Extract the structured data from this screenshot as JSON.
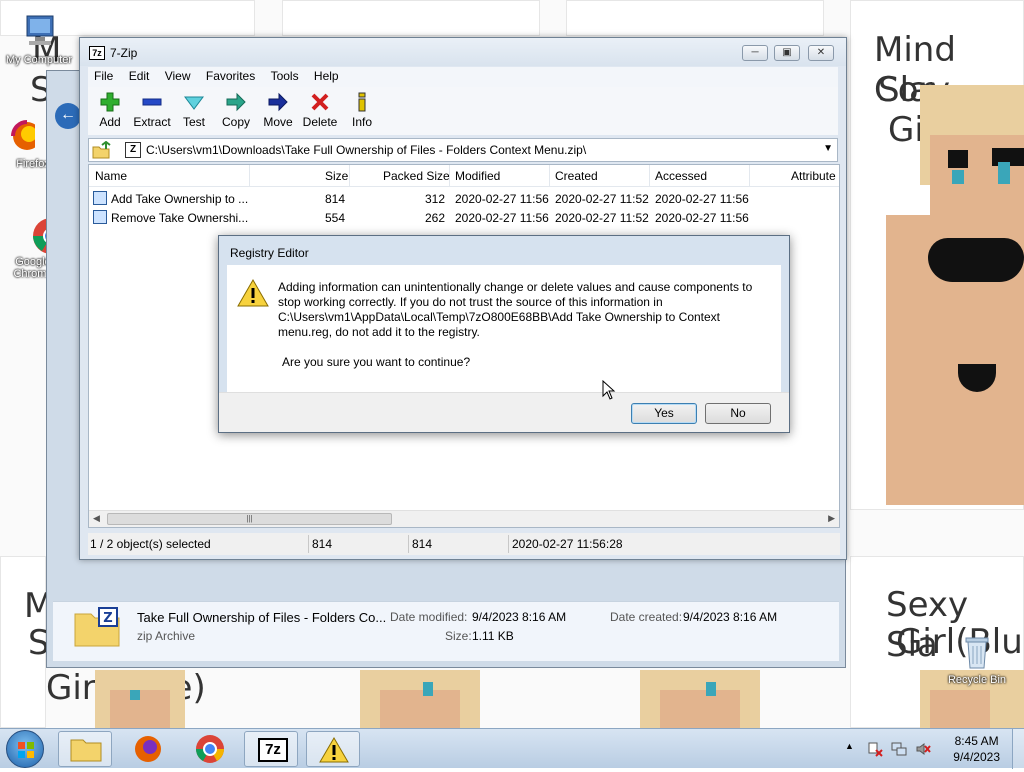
{
  "desktop": {
    "icons": [
      {
        "label": "My Computer"
      },
      {
        "label": "Firefox"
      },
      {
        "label": "Google Chrome"
      },
      {
        "label": "Recycle Bin"
      }
    ],
    "wallpaper_texts": [
      "Mind Cor",
      "Slav",
      "Gi",
      "Sexy Sla",
      "Girl(Blu",
      "Gir",
      "ue)",
      "Mi",
      "S",
      "M",
      "S"
    ]
  },
  "explorer": {
    "details": {
      "name": "Take Full Ownership of Files - Folders Co...",
      "type": "zip Archive",
      "modified_label": "Date modified:",
      "modified_value": "9/4/2023 8:16 AM",
      "created_label": "Date created:",
      "created_value": "9/4/2023 8:16 AM",
      "size_label": "Size:",
      "size_value": "1.11 KB"
    }
  },
  "zip": {
    "title": "7-Zip",
    "app_icon_text": "7z",
    "menu": [
      "File",
      "Edit",
      "View",
      "Favorites",
      "Tools",
      "Help"
    ],
    "toolbar": {
      "add": "Add",
      "extract": "Extract",
      "test": "Test",
      "copy": "Copy",
      "move": "Move",
      "delete": "Delete",
      "info": "Info"
    },
    "address": "C:\\Users\\vm1\\Downloads\\Take Full Ownership of Files - Folders Context Menu.zip\\",
    "columns": [
      "Name",
      "Size",
      "Packed Size",
      "Modified",
      "Created",
      "Accessed",
      "Attribute"
    ],
    "rows": [
      {
        "name": "Add Take Ownership to ...",
        "size": "814",
        "packed": "312",
        "modified": "2020-02-27 11:56",
        "created": "2020-02-27 11:52",
        "accessed": "2020-02-27 11:56"
      },
      {
        "name": "Remove Take Ownershi...",
        "size": "554",
        "packed": "262",
        "modified": "2020-02-27 11:56",
        "created": "2020-02-27 11:52",
        "accessed": "2020-02-27 11:56"
      }
    ],
    "status": {
      "selected": "1 / 2 object(s) selected",
      "size": "814",
      "packed": "814",
      "date": "2020-02-27 11:56:28"
    }
  },
  "dialog": {
    "title": "Registry Editor",
    "message": "Adding information can unintentionally change or delete values and cause components to stop working correctly. If you do not trust the source of this information in C:\\Users\\vm1\\AppData\\Local\\Temp\\7zO800E68BB\\Add Take Ownership to Context menu.reg, do not add it to the registry.",
    "question": "Are you sure you want to continue?",
    "yes": "Yes",
    "no": "No"
  },
  "taskbar": {
    "time": "8:45 AM",
    "date": "9/4/2023",
    "zip_label": "7z"
  }
}
